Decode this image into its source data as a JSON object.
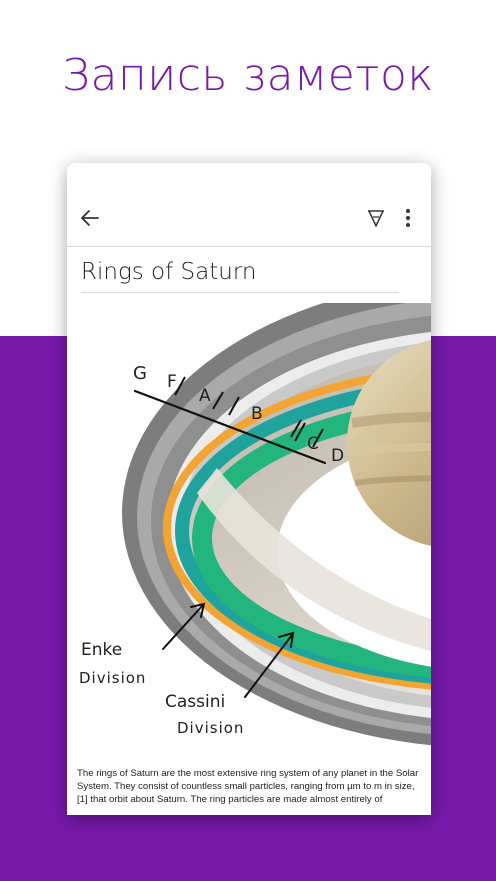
{
  "headline": "Запись заметок",
  "app": {
    "back_icon": "arrow-left-icon",
    "ink_icon": "pen-ink-icon",
    "more_icon": "more-vertical-icon"
  },
  "note": {
    "title": "Rings of Saturn",
    "body": "The rings of Saturn are the most extensive ring system of any planet in the Solar System. They consist of countless small particles, ranging from µm to m in size,[1] that orbit about Saturn. The ring particles are made almost entirely of"
  },
  "illustration": {
    "ring_labels": [
      "G",
      "F",
      "A",
      "B",
      "C",
      "D"
    ],
    "annotation_1_line_1": "Enke",
    "annotation_1_line_2": "Division",
    "annotation_2_line_1": "Cassini",
    "annotation_2_line_2": "Division"
  },
  "colors": {
    "brand_purple": "#7719aa",
    "ring_orange": "#f2a533",
    "ring_teal": "#1fa39c",
    "ring_green": "#23b57e"
  }
}
